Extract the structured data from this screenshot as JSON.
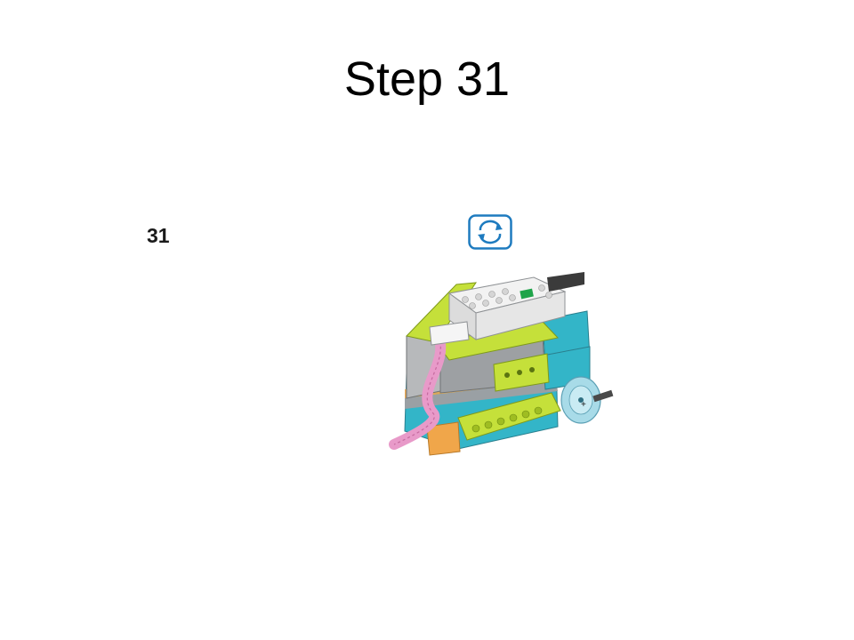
{
  "slide": {
    "title": "Step 31",
    "step_number": "31"
  },
  "icons": {
    "rotate": "rotate-model-icon",
    "rotate_color": "#1e7bbf"
  },
  "illustration": {
    "name": "lego-wedo-model-step-31",
    "colors": {
      "lime": "#c5e03a",
      "teal": "#33b5c8",
      "gray": "#a9abae",
      "white": "#f2f2f2",
      "pink": "#e89ac9",
      "orange": "#f0a64a",
      "transparent_blue": "#a8dbe8"
    }
  }
}
